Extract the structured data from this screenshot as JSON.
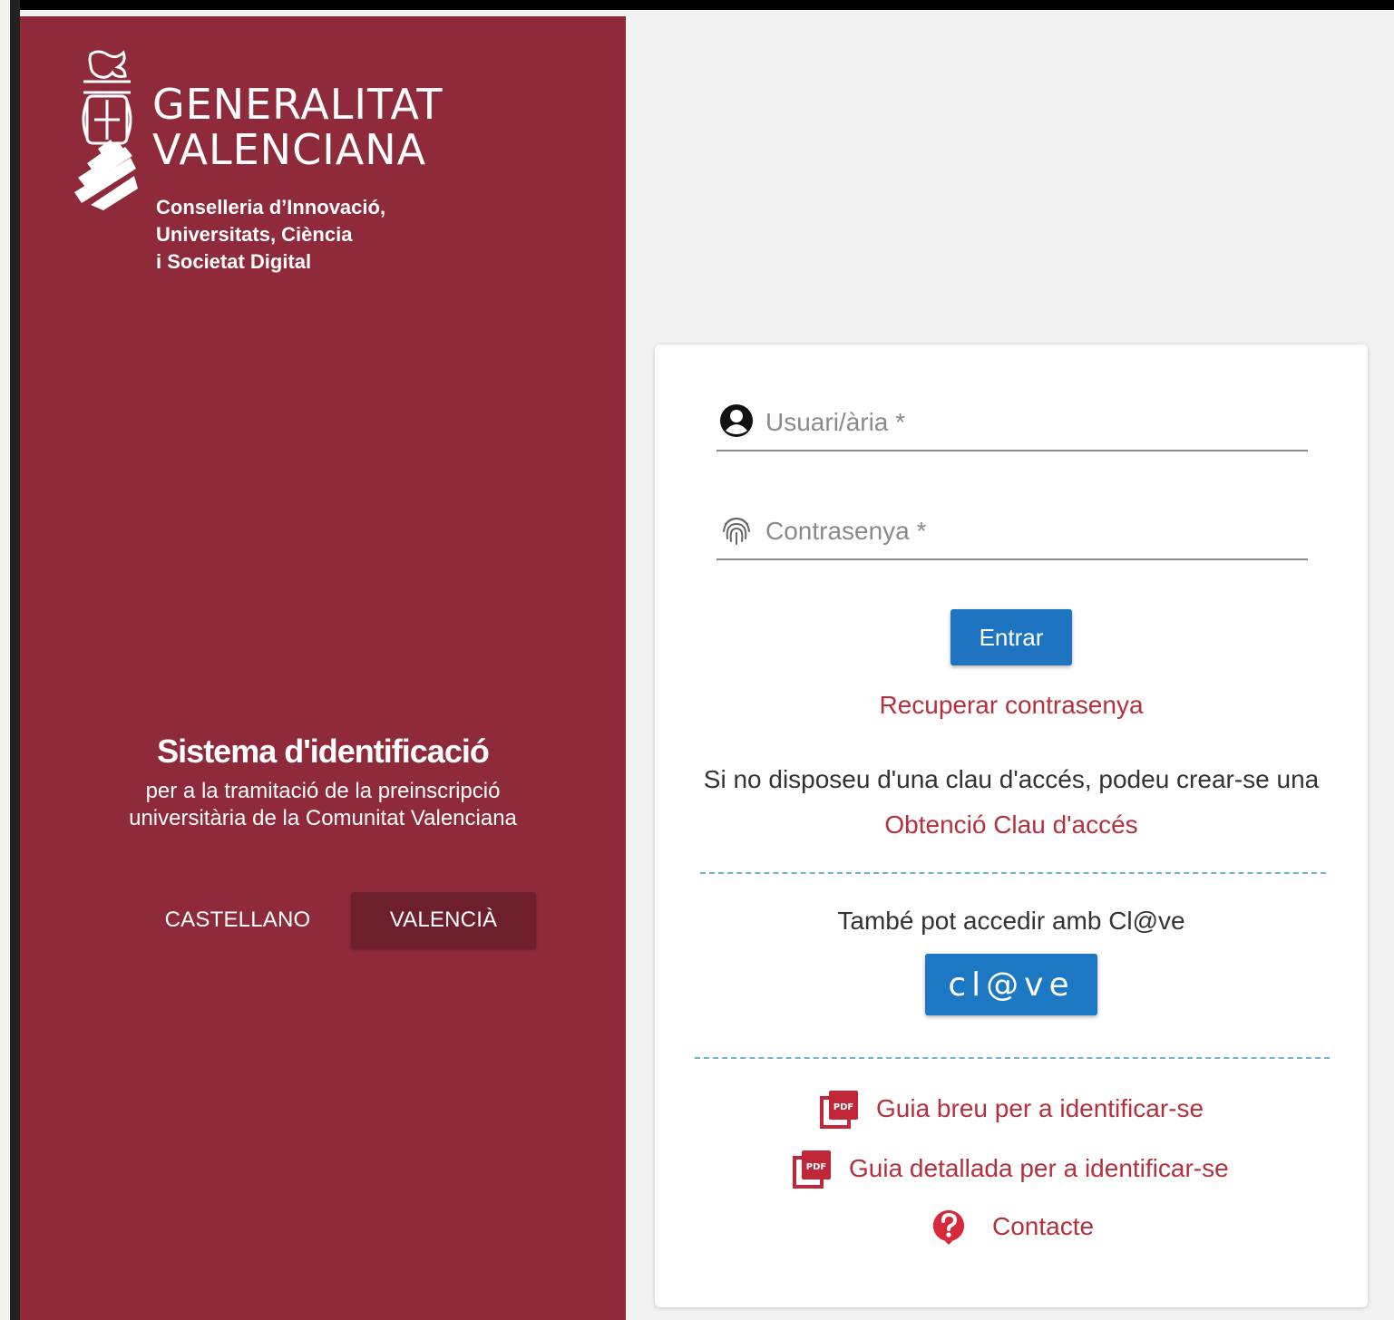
{
  "brand": {
    "name": "GENERALITAT\nVALENCIANA",
    "department": "Conselleria d’Innovació,\nUniversitats, Ciència\ni Societat Digital"
  },
  "intro": {
    "title": "Sistema d'identificació",
    "subtitle": "per a la tramitació de la preinscripció\nuniversitària de la Comunitat Valenciana"
  },
  "language": {
    "options": [
      "CASTELLANO",
      "VALENCIÀ"
    ],
    "selected": "VALENCIÀ"
  },
  "login": {
    "user_placeholder": "Usuari/ària *",
    "user_value": "",
    "password_placeholder": "Contrasenya *",
    "password_value": "",
    "submit_label": "Entrar",
    "recover_link": "Recuperar contrasenya",
    "no_key_text": "Si no disposeu d'una clau d'accés, podeu crear-se una",
    "obtain_key_link": "Obtenció Clau d'accés",
    "clave_text": "També pot accedir amb Cl@ve",
    "clave_button": "cl@ve"
  },
  "resources": [
    {
      "label": "Guia breu per a identificar-se",
      "icon": "pdf-icon"
    },
    {
      "label": "Guia detallada per a identificar-se",
      "icon": "pdf-icon"
    },
    {
      "label": "Contacte",
      "icon": "help-icon"
    }
  ],
  "colors": {
    "panel": "#8e2a3a",
    "panel_dark": "#6e1f2c",
    "link": "#b5303f",
    "button": "#1f74c2",
    "divider": "#6bb6c8"
  }
}
